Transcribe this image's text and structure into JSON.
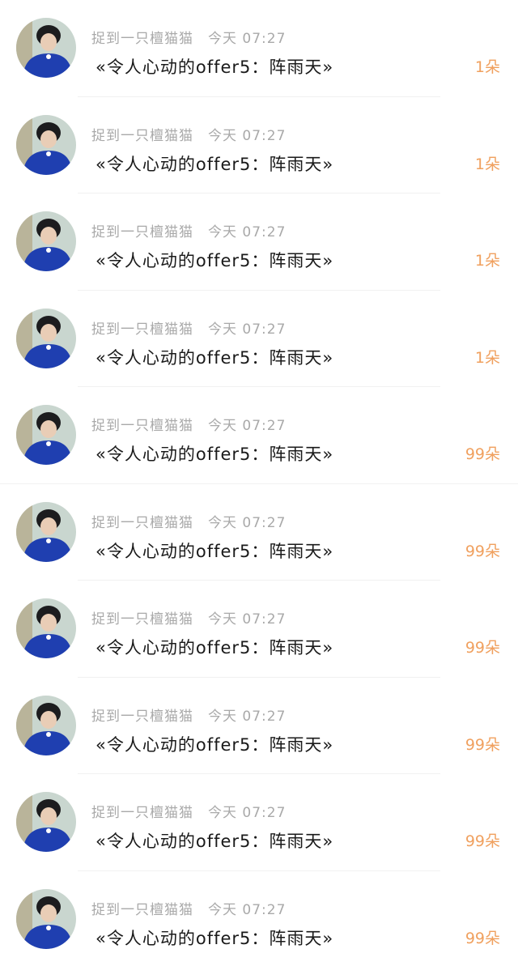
{
  "colors": {
    "name_text": "#a9a9a9",
    "gift_text": "#1a1a1a",
    "count_text": "#f0a05e",
    "divider": "#f1f1f1",
    "avatar_shirt": "#1f3fb0"
  },
  "items": [
    {
      "avatar_icon": "user-avatar-photo",
      "name": "捉到一只檀猫猫",
      "time": "今天 07:27",
      "gift": "«令人心动的offer5：阵雨天»",
      "count": "1朵"
    },
    {
      "avatar_icon": "user-avatar-photo",
      "name": "捉到一只檀猫猫",
      "time": "今天 07:27",
      "gift": "«令人心动的offer5：阵雨天»",
      "count": "1朵"
    },
    {
      "avatar_icon": "user-avatar-photo",
      "name": "捉到一只檀猫猫",
      "time": "今天 07:27",
      "gift": "«令人心动的offer5：阵雨天»",
      "count": "1朵"
    },
    {
      "avatar_icon": "user-avatar-photo",
      "name": "捉到一只檀猫猫",
      "time": "今天 07:27",
      "gift": "«令人心动的offer5：阵雨天»",
      "count": "1朵"
    },
    {
      "avatar_icon": "user-avatar-photo",
      "name": "捉到一只檀猫猫",
      "time": "今天 07:27",
      "gift": "«令人心动的offer5：阵雨天»",
      "count": "99朵"
    },
    {
      "avatar_icon": "user-avatar-photo",
      "name": "捉到一只檀猫猫",
      "time": "今天 07:27",
      "gift": "«令人心动的offer5：阵雨天»",
      "count": "99朵"
    },
    {
      "avatar_icon": "user-avatar-photo",
      "name": "捉到一只檀猫猫",
      "time": "今天 07:27",
      "gift": "«令人心动的offer5：阵雨天»",
      "count": "99朵"
    },
    {
      "avatar_icon": "user-avatar-photo",
      "name": "捉到一只檀猫猫",
      "time": "今天 07:27",
      "gift": "«令人心动的offer5：阵雨天»",
      "count": "99朵"
    },
    {
      "avatar_icon": "user-avatar-photo",
      "name": "捉到一只檀猫猫",
      "time": "今天 07:27",
      "gift": "«令人心动的offer5：阵雨天»",
      "count": "99朵"
    },
    {
      "avatar_icon": "user-avatar-photo",
      "name": "捉到一只檀猫猫",
      "time": "今天 07:27",
      "gift": "«令人心动的offer5：阵雨天»",
      "count": "99朵"
    }
  ]
}
